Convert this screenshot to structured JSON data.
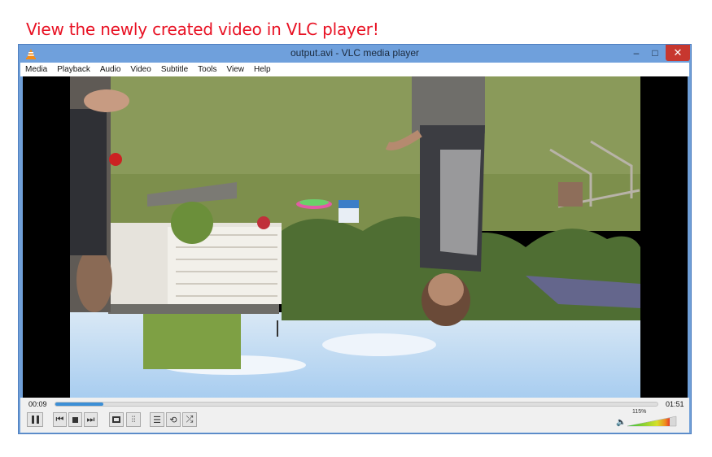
{
  "caption": "View the newly created video in VLC player!",
  "window": {
    "title": "output.avi - VLC media player",
    "minimize_glyph": "–",
    "maximize_glyph": "□",
    "close_glyph": "✕"
  },
  "menu": [
    "Media",
    "Playback",
    "Audio",
    "Video",
    "Subtitle",
    "Tools",
    "View",
    "Help"
  ],
  "playback": {
    "elapsed": "00:09",
    "total": "01:51",
    "progress_fraction": 0.08
  },
  "volume": {
    "label": "115%",
    "level_percent": 115
  },
  "colors": {
    "caption": "#e81123",
    "seek_fill": "#3c8fd6",
    "close_button": "#c7372f",
    "title_bar": "#6fa0dc"
  },
  "icons": {
    "app": "vlc-cone-icon",
    "pause": "pause-icon",
    "previous": "previous-icon",
    "stop": "stop-icon",
    "next": "next-icon",
    "fullscreen": "fullscreen-icon",
    "extended": "extended-settings-icon",
    "playlist": "playlist-icon",
    "loop": "loop-icon",
    "random": "random-icon",
    "speaker": "speaker-icon"
  }
}
